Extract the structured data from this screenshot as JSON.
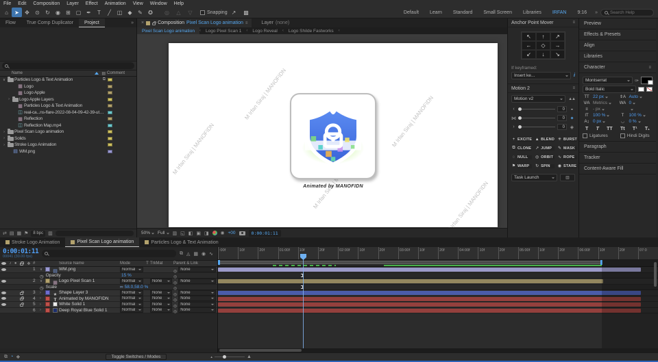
{
  "menu": {
    "items": [
      "File",
      "Edit",
      "Composition",
      "Layer",
      "Effect",
      "Animation",
      "View",
      "Window",
      "Help"
    ]
  },
  "toolbar": {
    "tools": [
      {
        "glyph": "⌂",
        "name": "home-icon"
      },
      {
        "glyph": "➤",
        "name": "selection-tool-icon",
        "cls": "sel"
      },
      {
        "glyph": "✥",
        "name": "hand-tool-icon"
      },
      {
        "glyph": "⊙",
        "name": "zoom-tool-icon"
      },
      {
        "glyph": "↻",
        "name": "rotate-tool-icon"
      },
      {
        "glyph": "◉",
        "name": "camera-tool-icon"
      },
      {
        "glyph": "⊞",
        "name": "pan-behind-tool-icon"
      },
      {
        "glyph": "▢",
        "name": "shape-tool-icon"
      },
      {
        "glyph": "✒",
        "name": "pen-tool-icon"
      },
      {
        "glyph": "T",
        "name": "type-tool-icon"
      },
      {
        "glyph": "╱",
        "name": "brush-tool-icon"
      },
      {
        "glyph": "◫",
        "name": "clone-stamp-tool-icon"
      },
      {
        "glyph": "◆",
        "name": "eraser-tool-icon"
      },
      {
        "glyph": "✎",
        "name": "roto-brush-tool-icon"
      },
      {
        "glyph": "✪",
        "name": "puppet-tool-icon"
      }
    ],
    "dim_tools": [
      {
        "glyph": "◎",
        "name": "axis-widget-icon"
      },
      {
        "glyph": "△",
        "name": "widget-up-icon"
      },
      {
        "glyph": "▽",
        "name": "widget-down-icon"
      }
    ],
    "snapping_label": "Snapping",
    "extra_icons": [
      {
        "glyph": "↗",
        "name": "snap-angle-icon"
      },
      {
        "glyph": "▩",
        "name": "pixel-grid-icon"
      }
    ],
    "workspaces": [
      {
        "label": "Default",
        "cls": ""
      },
      {
        "label": "Learn",
        "c1s": "",
        "cls": ""
      },
      {
        "label": "Standard",
        "cls": ""
      },
      {
        "label": "Small Screen",
        "cls": ""
      },
      {
        "label": "Libraries",
        "cls": ""
      },
      {
        "label": "IRFAN",
        "cls": "active"
      },
      {
        "label": "9:16",
        "cls": ""
      }
    ],
    "search_placeholder": "Search Help"
  },
  "left": {
    "tabs": [
      {
        "label": "Flow",
        "cls": ""
      },
      {
        "label": "True Comp Duplicator",
        "cls": ""
      },
      {
        "label": "Project",
        "cls": "active"
      }
    ],
    "columns": {
      "name": "Name",
      "comment": "Comment"
    },
    "items": [
      {
        "pad": "2px",
        "twirl": "∨",
        "type": "p-folder",
        "name": "Particles Logo & Text Animation",
        "chip": "#cfc161",
        "net": "⧉"
      },
      {
        "pad": "16px",
        "twirl": "",
        "type": "p-comp",
        "name": "Logo",
        "chip": "#b3a26d",
        "net": ""
      },
      {
        "pad": "16px",
        "twirl": "",
        "type": "p-comp",
        "name": "Logo Apple",
        "chip": "#b3a26d",
        "net": ""
      },
      {
        "pad": "9px",
        "twirl": "›",
        "type": "p-folder",
        "name": "Logo Apple Layers",
        "chip": "#cfc161",
        "net": ""
      },
      {
        "pad": "16px",
        "twirl": "",
        "type": "p-comp",
        "name": "Particles Logo & Text Animation",
        "chip": "#b3a26d",
        "net": ""
      },
      {
        "pad": "16px",
        "twirl": "",
        "type": "p-movie",
        "name": "real-ca...ns-flare-2022-08-04-09-42-39-utc.mov",
        "chip": "#6fc9ce",
        "net": ""
      },
      {
        "pad": "16px",
        "twirl": "",
        "type": "p-comp",
        "name": "Reflection",
        "chip": "#b3a26d",
        "net": ""
      },
      {
        "pad": "16px",
        "twirl": "",
        "type": "p-movie",
        "name": "Reflection Map.mp4",
        "chip": "#6fc9ce",
        "net": ""
      },
      {
        "pad": "2px",
        "twirl": "›",
        "type": "p-folder",
        "name": "Pixel Scan Logo animation",
        "chip": "#cfc161",
        "net": ""
      },
      {
        "pad": "2px",
        "twirl": "›",
        "type": "p-folder",
        "name": "Solids",
        "chip": "#cfc161",
        "net": ""
      },
      {
        "pad": "2px",
        "twirl": "›",
        "type": "p-folder",
        "name": "Stroke Logo Animation",
        "chip": "#cfc161",
        "net": ""
      },
      {
        "pad": "9px",
        "twirl": "",
        "type": "p-png",
        "name": "WM.png",
        "chip": "#9a99d2",
        "net": ""
      }
    ],
    "bit_depth": "8 bpc"
  },
  "viewer": {
    "tab_composition": "Composition",
    "tab_composition_name": "Pixel Scan Logo animation",
    "tab_layer": "Layer",
    "tab_layer_value": "(none)",
    "comp_tabs": [
      {
        "label": "Pixel Scan Logo animation",
        "cls": "active"
      },
      {
        "label": "Logo Pixel Scan 1",
        "cls": ""
      },
      {
        "label": "Logo Reveal",
        "cls": ""
      },
      {
        "label": "Logo Shilde Fastworks",
        "cls": ""
      }
    ],
    "zoom": "50%",
    "resolution": "Full",
    "exposure": "+00",
    "timecode": "0:00:01:11",
    "canvas": {
      "caption": "Animated by MANOFIDN",
      "watermark": "M Irfan Siraj | MANOFIDN"
    }
  },
  "anchor_panel": {
    "title": "Anchor Point Mover",
    "arrows": [
      "↖",
      "↑",
      "↗",
      "←",
      "◇",
      "→",
      "↙",
      "↓",
      "↘"
    ],
    "if_keyframed": "If keyframed:",
    "insert_dropdown": "Insert ke...",
    "info": "i"
  },
  "motion_panel": {
    "title": "Motion 2",
    "preset": "Motion v2",
    "sliders": [
      {
        "lead": "‹",
        "value": "0",
        "end": "◒",
        "endcls": "",
        "endname": "bell-icon"
      },
      {
        "lead": "⋈",
        "value": "0",
        "end": "✦",
        "endcls": "blue",
        "endname": "feather-icon"
      },
      {
        "lead": "›",
        "value": "0",
        "end": "◈",
        "endcls": "",
        "endname": "thermometer-icon"
      }
    ],
    "tools": [
      {
        "glyph": "+",
        "label": "EXCITE"
      },
      {
        "glyph": "▲",
        "label": "BLEND"
      },
      {
        "glyph": "✳",
        "label": "BURST"
      },
      {
        "glyph": "⧉",
        "label": "CLONE"
      },
      {
        "glyph": "↗",
        "label": "JUMP"
      },
      {
        "glyph": "✎",
        "label": "MASK"
      },
      {
        "glyph": "◌",
        "label": "NULL"
      },
      {
        "glyph": "◎",
        "label": "ORBIT"
      },
      {
        "glyph": "∿",
        "label": "ROPE"
      },
      {
        "glyph": "⚑",
        "label": "WARP"
      },
      {
        "glyph": "↻",
        "label": "SPIN"
      },
      {
        "glyph": "◉",
        "label": "STARE"
      }
    ],
    "task": "Task Launch"
  },
  "right_stack": {
    "top": [
      {
        "label": "Preview"
      },
      {
        "label": "Effects & Presets"
      },
      {
        "label": "Align"
      },
      {
        "label": "Libraries"
      }
    ],
    "bottom": [
      {
        "label": "Paragraph"
      },
      {
        "label": "Tracker"
      },
      {
        "label": "Content-Aware Fill"
      }
    ]
  },
  "character": {
    "title": "Character",
    "font": "Montserrat",
    "style": "Bold Italic",
    "rows": [
      {
        "icon1": "TT",
        "value1": "22 px",
        "dim1": "",
        "icon2": "⇕A",
        "value2": "Auto",
        "dim2": ""
      },
      {
        "icon1": "V∕A",
        "value1": "Metrics",
        "dim1": "dim",
        "icon2": "WA",
        "value2": "0",
        "dim2": ""
      },
      {
        "icon1": "≡",
        "value1": "- px",
        "dim1": "dim",
        "icon2": "",
        "value2": "",
        "dim2": ""
      },
      {
        "icon1": "IT",
        "value1": "100 %",
        "dim1": "",
        "icon2": "T",
        "value2": "100 %",
        "dim2": ""
      },
      {
        "icon1": "A↨",
        "value1": "0 px",
        "dim1": "",
        "icon2": "◡",
        "value2": "0 %",
        "dim2": ""
      }
    ],
    "faux": [
      {
        "g": "T",
        "cls": ""
      },
      {
        "g": "T",
        "cls": "i"
      },
      {
        "g": "TT",
        "cls": ""
      },
      {
        "g": "Tt",
        "cls": ""
      },
      {
        "g": "T¹",
        "cls": ""
      },
      {
        "g": "T₁",
        "cls": ""
      }
    ],
    "ligatures": "Ligatures",
    "hindi_digits": "Hindi Digits"
  },
  "timeline": {
    "tabs": [
      {
        "label": "Stroke Logo Animation",
        "cls": ""
      },
      {
        "label": "Pixel Scan Logo animation",
        "cls": "active"
      },
      {
        "label": "Particles Logo & Text Animation",
        "cls": ""
      }
    ],
    "timecode": "0:00:01:11",
    "frame_info": "00041 (30.00 fps)",
    "columns": {
      "num": "#",
      "source_name": "Source Name",
      "mode": "Mode",
      "t": "T",
      "trkmat": "TrkMat",
      "parent": "Parent & Link"
    },
    "rows": [
      {
        "kind": "layer",
        "eye": "eye-on",
        "lock": "",
        "twirl": "∨",
        "num": "1",
        "chip": "#9a99d2",
        "icon": "ic-png",
        "name": "WM.png",
        "mode": "Normal",
        "tmv": "hid",
        "trkmat": "",
        "parent": "None",
        "bar": "#9b9ac9",
        "barw": "bar-full"
      },
      {
        "kind": "prop",
        "eye": "",
        "lock": "",
        "name": "Opacity",
        "prefix": "",
        "value": "15 %",
        "bar": "",
        "barw": ""
      },
      {
        "kind": "layer",
        "eye": "eye-on",
        "lock": "",
        "twirl": "∨",
        "num": "2",
        "chip": "#b3a26d",
        "icon": "ic-comp",
        "name": "Logo Pixel Scan 1",
        "mode": "Normal",
        "tmv": "",
        "trkmat": "None",
        "parent": "None",
        "bar": "#93875f",
        "barw": "bar-part"
      },
      {
        "kind": "prop",
        "eye": "",
        "lock": "",
        "name": "Scale",
        "prefix": "∞",
        "value": "58.0,58.0 %",
        "bar": "",
        "barw": ""
      },
      {
        "kind": "layer",
        "eye": "eye-on",
        "lock": "lock-on",
        "twirl": "›",
        "num": "3",
        "chip": "#6e6ed0",
        "icon": "ic-shape",
        "name": "Shape Layer 3",
        "mode": "Normal",
        "tmv": "",
        "trkmat": "None",
        "parent": "None",
        "bar": "#4a5caa",
        "barw": "bar-full"
      },
      {
        "kind": "layer",
        "eye": "eye-on",
        "lock": "lock-on",
        "twirl": "›",
        "num": "4",
        "chip": "#c0504a",
        "icon": "ic-text",
        "name": "Animated by MANOFIDN",
        "mode": "Normal",
        "tmv": "",
        "trkmat": "None",
        "parent": "None",
        "bar": "#94403d",
        "barw": "bar-full"
      },
      {
        "kind": "layer",
        "eye": "eye-on",
        "lock": "lock-on",
        "twirl": "›",
        "num": "5",
        "chip": "#c0504a",
        "icon": "ic-wsolid",
        "name": "White Solid 1",
        "mode": "Normal",
        "tmv": "",
        "trkmat": "None",
        "parent": "None",
        "bar": "#94403d",
        "barw": "bar-full"
      },
      {
        "kind": "layer",
        "eye": "",
        "lock": "",
        "twirl": "›",
        "num": "6",
        "chip": "#c0504a",
        "icon": "ic-bsolid",
        "name": "Deep Royal Blue Solid 1",
        "mode": "Normal",
        "tmv": "",
        "trkmat": "None",
        "parent": "None",
        "bar": "#94403d",
        "barw": "bar-full"
      }
    ],
    "ruler": [
      ":00f",
      "10f",
      "20f",
      "01:00f",
      "10f",
      "20f",
      "02:00f",
      "10f",
      "20f",
      "03:00f",
      "10f",
      "20f",
      "04:00f",
      "10f",
      "20f",
      "05:00f",
      "10f",
      "20f",
      "06:00f",
      "10f",
      "20f",
      "07:0"
    ],
    "control_icons": [
      {
        "glyph": "⧉",
        "name": "comp-mini-flowchart-icon"
      },
      {
        "glyph": "◬",
        "name": "draft-3d-icon"
      },
      {
        "glyph": "▦",
        "name": "frame-blending-icon"
      },
      {
        "glyph": "◉",
        "name": "motion-blur-icon"
      },
      {
        "glyph": "∿",
        "name": "graph-editor-icon"
      }
    ],
    "bottom_icons": [
      {
        "glyph": "⧉",
        "name": "frame-blend-toggle-icon",
        "cls": ""
      },
      {
        "glyph": "◔",
        "name": "motion-blur-toggle-icon",
        "cls": "blue"
      },
      {
        "glyph": "❖",
        "name": "brainstorm-icon",
        "cls": ""
      }
    ],
    "toggle_button": "Toggle Switches / Modes"
  },
  "project_foot_icons": [
    {
      "glyph": "⇄",
      "name": "interpret-footage-icon"
    },
    {
      "glyph": "▤",
      "name": "new-folder-icon"
    },
    {
      "glyph": "▦",
      "name": "new-composition-icon"
    },
    {
      "glyph": "⚑",
      "name": "project-flowchart-icon"
    }
  ]
}
